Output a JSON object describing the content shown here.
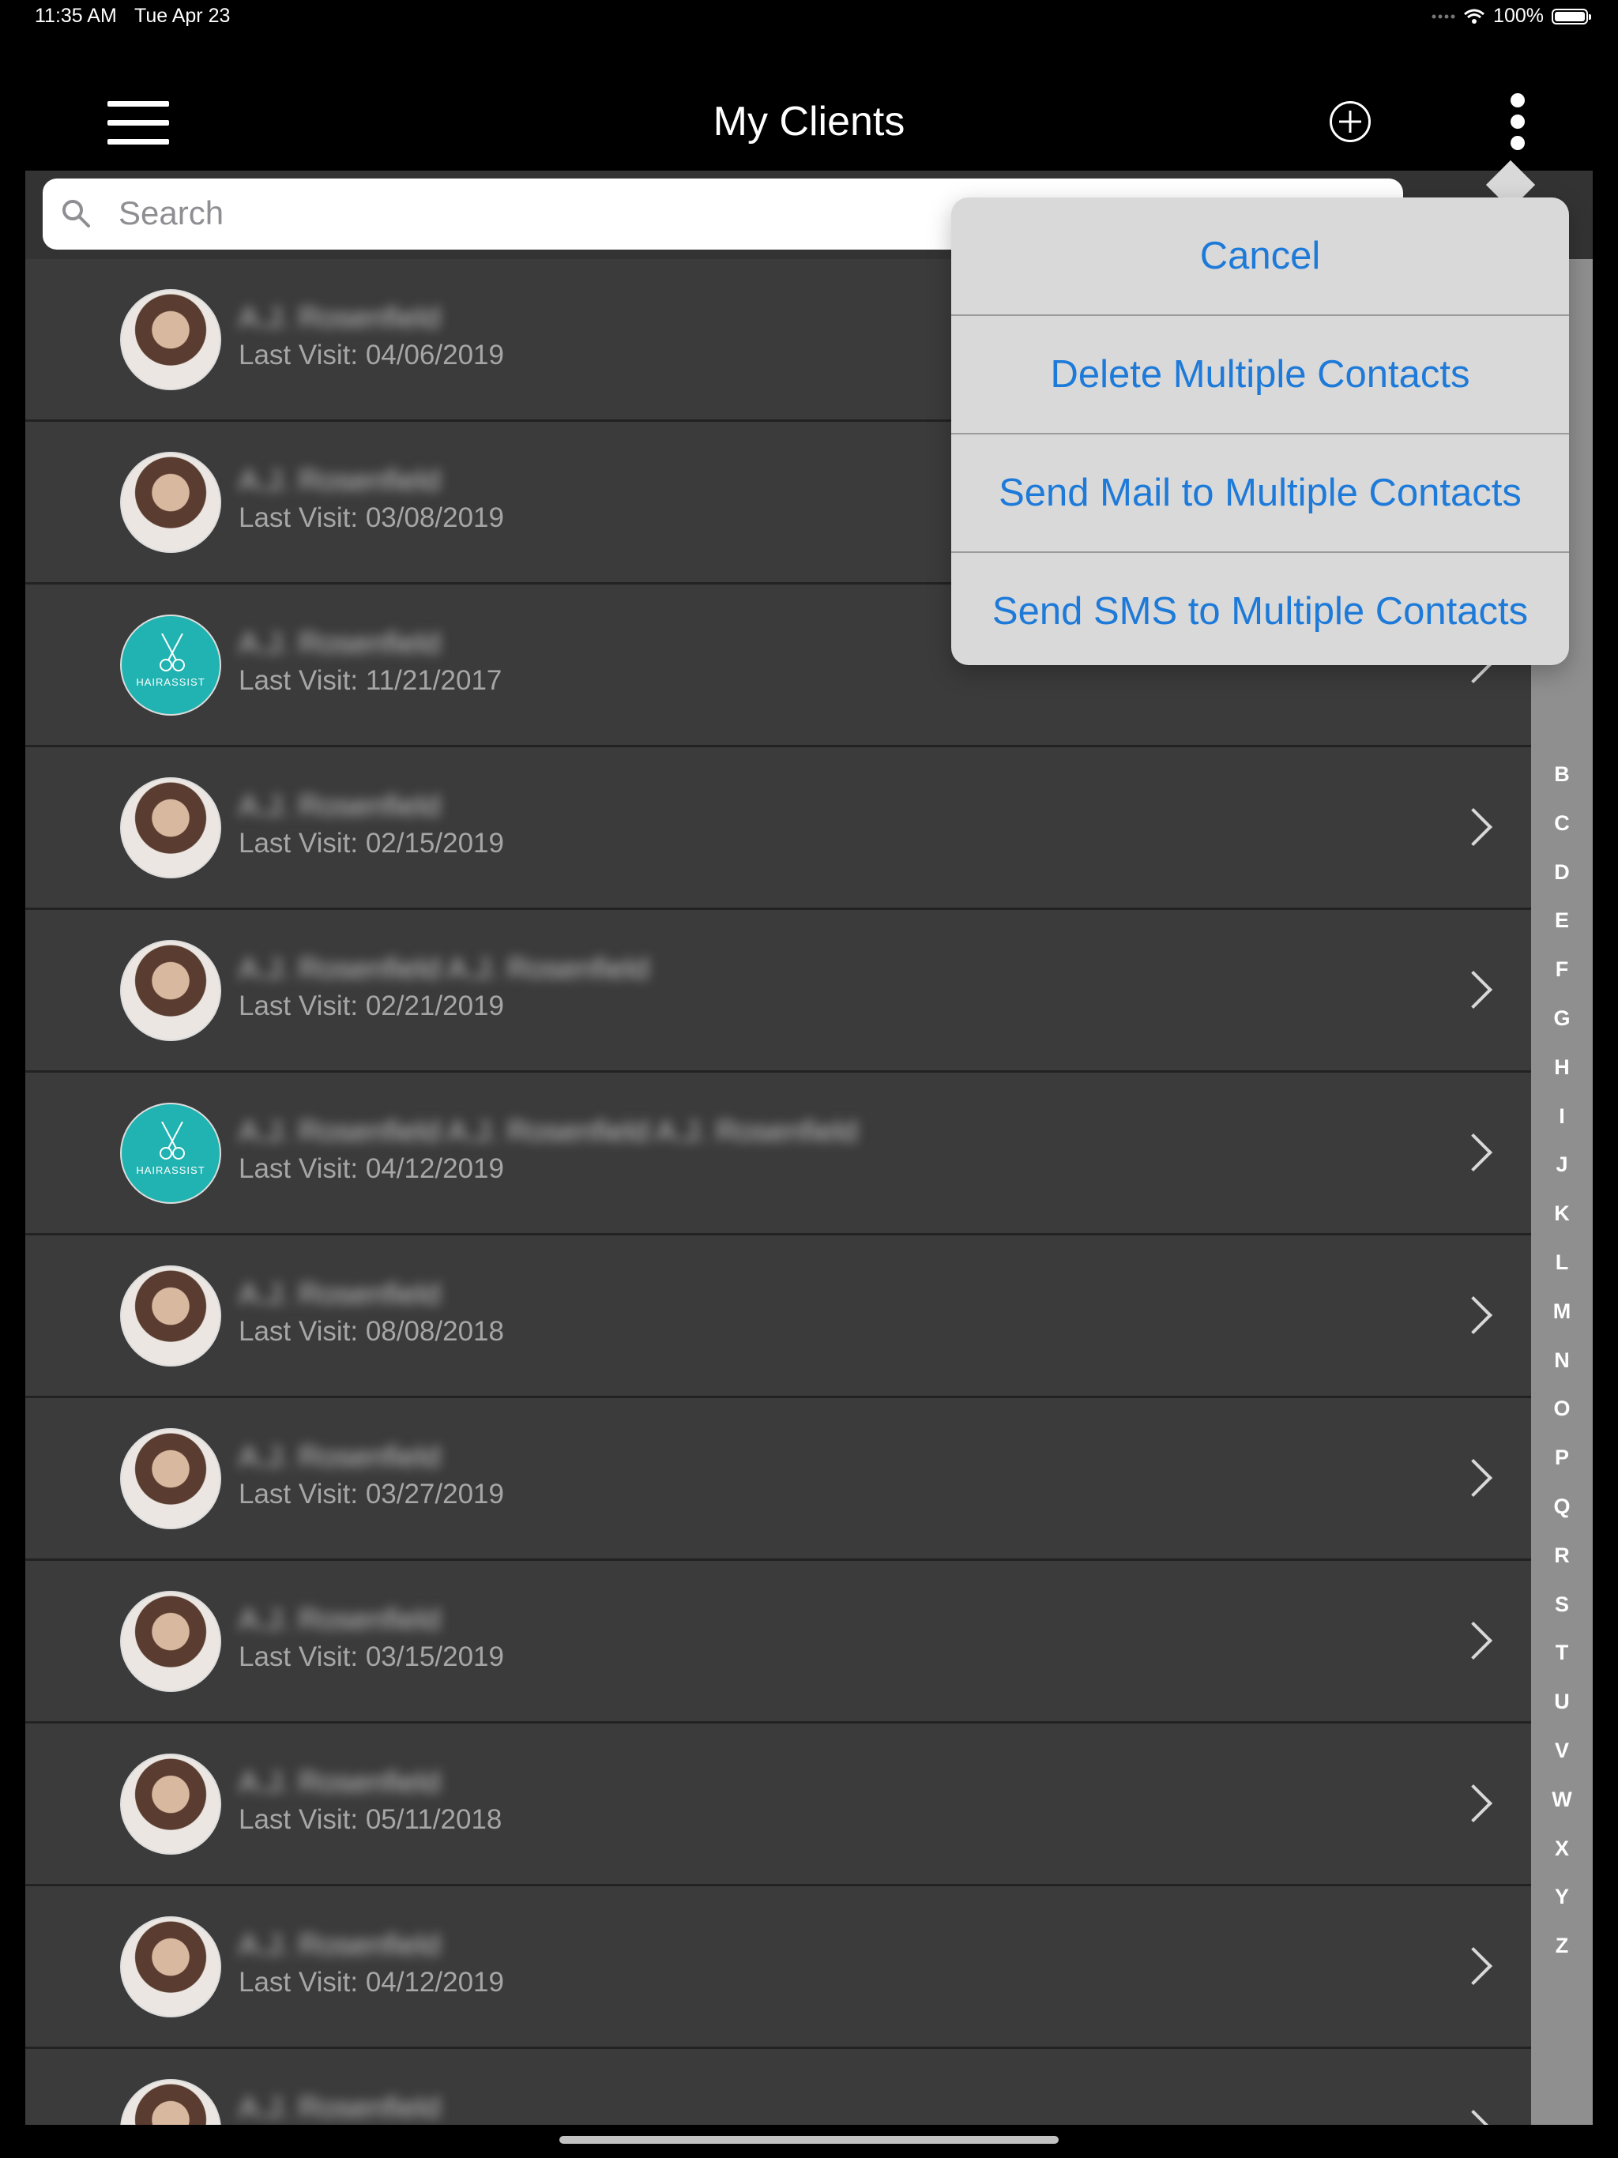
{
  "status_bar": {
    "time": "11:35 AM",
    "date": "Tue Apr 23",
    "battery_percent": "100%",
    "icons": [
      "signal-dots-icon",
      "wifi-icon",
      "battery-icon"
    ]
  },
  "header": {
    "title": "My Clients",
    "icons": [
      "hamburger-menu-icon",
      "add-circle-icon",
      "more-vertical-icon"
    ]
  },
  "search": {
    "placeholder": "Search"
  },
  "clients": [
    {
      "name": "A.J. Rosenfield",
      "last_visit": "Last Visit: 04/06/2019",
      "avatar": "photo"
    },
    {
      "name": "A.J. Rosenfield",
      "last_visit": "Last Visit: 03/08/2019",
      "avatar": "photo"
    },
    {
      "name": "A.J. Rosenfield",
      "last_visit": "Last Visit: 11/21/2017",
      "avatar": "hairassist"
    },
    {
      "name": "A.J. Rosenfield",
      "last_visit": "Last Visit: 02/15/2019",
      "avatar": "photo"
    },
    {
      "name": "A.J. Rosenfield A.J. Rosenfield",
      "last_visit": "Last Visit: 02/21/2019",
      "avatar": "photo"
    },
    {
      "name": "A.J. Rosenfield A.J. Rosenfield A.J. Rosenfield",
      "last_visit": "Last Visit: 04/12/2019",
      "avatar": "hairassist"
    },
    {
      "name": "A.J. Rosenfield",
      "last_visit": "Last Visit: 08/08/2018",
      "avatar": "photo"
    },
    {
      "name": "A.J. Rosenfield",
      "last_visit": "Last Visit: 03/27/2019",
      "avatar": "photo"
    },
    {
      "name": "A.J. Rosenfield",
      "last_visit": "Last Visit: 03/15/2019",
      "avatar": "photo"
    },
    {
      "name": "A.J. Rosenfield",
      "last_visit": "Last Visit: 05/11/2018",
      "avatar": "photo"
    },
    {
      "name": "A.J. Rosenfield",
      "last_visit": "Last Visit: 04/12/2019",
      "avatar": "photo"
    },
    {
      "name": "A.J. Rosenfield",
      "last_visit": "",
      "avatar": "photo"
    }
  ],
  "brand_avatar_text": "HAIRASSIST",
  "index_letters": [
    "B",
    "C",
    "D",
    "E",
    "F",
    "G",
    "H",
    "I",
    "J",
    "K",
    "L",
    "M",
    "N",
    "O",
    "P",
    "Q",
    "R",
    "S",
    "T",
    "U",
    "V",
    "W",
    "X",
    "Y",
    "Z"
  ],
  "popover_menu": {
    "items": [
      "Cancel",
      "Delete Multiple Contacts",
      "Send Mail to Multiple Contacts",
      "Send SMS to Multiple Contacts"
    ]
  },
  "colors": {
    "accent": "#1e7ad9",
    "brand_avatar": "#20b3b1",
    "list_background": "#3b3b3b",
    "index_bar": "#8f8f8f"
  }
}
